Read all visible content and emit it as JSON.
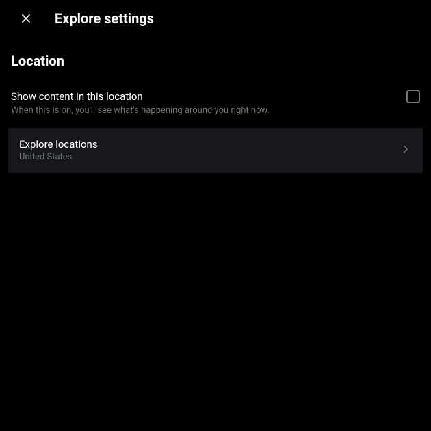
{
  "header": {
    "title": "Explore settings"
  },
  "section": {
    "heading": "Location"
  },
  "setting": {
    "title": "Show content in this location",
    "description": "When this is on, you'll see what's happening around you right now."
  },
  "explore": {
    "title": "Explore locations",
    "subtitle": "United States"
  }
}
